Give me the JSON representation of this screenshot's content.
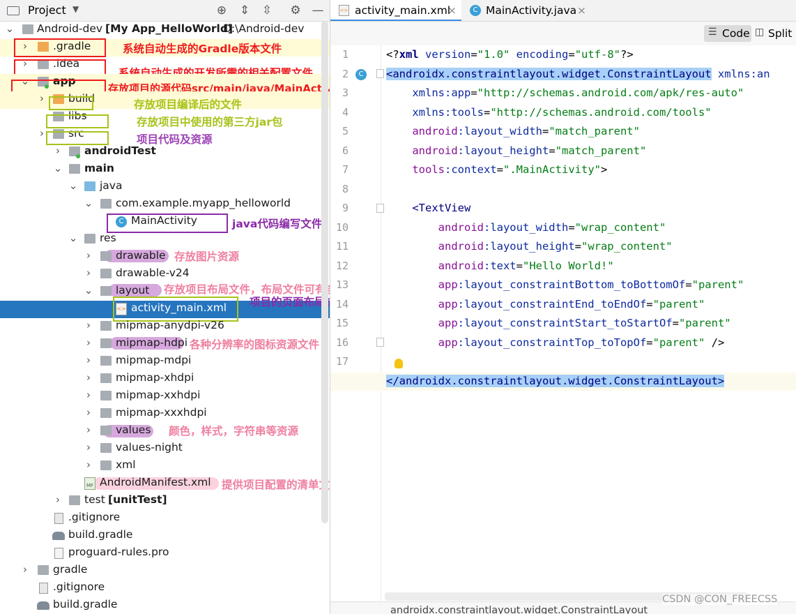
{
  "left_panel": {
    "header": {
      "title": "Project",
      "dropdown_glyph": "▼",
      "tools": [
        "locate-icon",
        "expand-icon",
        "collapse-icon",
        "gear-icon",
        "minimize-icon"
      ]
    },
    "tree": [
      {
        "arrow": "⌄",
        "label": "Android-dev",
        "bold_suffix": "[My App_HelloWorld]",
        "path": "D:\\Android-dev"
      },
      {
        "arrow": "›",
        "label": ".gradle"
      },
      {
        "arrow": "›",
        "label": ".idea"
      },
      {
        "arrow": "⌄",
        "label": "app"
      },
      {
        "arrow": "›",
        "label": "build"
      },
      {
        "arrow": "",
        "label": "libs"
      },
      {
        "arrow": "›",
        "label": "src"
      },
      {
        "arrow": "›",
        "label": "androidTest"
      },
      {
        "arrow": "⌄",
        "label": "main"
      },
      {
        "arrow": "⌄",
        "label": "java"
      },
      {
        "arrow": "⌄",
        "label": "com.example.myapp_helloworld"
      },
      {
        "arrow": "",
        "label": "MainActivity"
      },
      {
        "arrow": "⌄",
        "label": "res"
      },
      {
        "arrow": "›",
        "label": "drawable"
      },
      {
        "arrow": "›",
        "label": "drawable-v24"
      },
      {
        "arrow": "⌄",
        "label": "layout"
      },
      {
        "arrow": "",
        "label": "activity_main.xml"
      },
      {
        "arrow": "›",
        "label": "mipmap-anydpi-v26"
      },
      {
        "arrow": "›",
        "label": "mipmap-hdpi"
      },
      {
        "arrow": "›",
        "label": "mipmap-mdpi"
      },
      {
        "arrow": "›",
        "label": "mipmap-xhdpi"
      },
      {
        "arrow": "›",
        "label": "mipmap-xxhdpi"
      },
      {
        "arrow": "›",
        "label": "mipmap-xxxhdpi"
      },
      {
        "arrow": "›",
        "label": "values"
      },
      {
        "arrow": "›",
        "label": "values-night"
      },
      {
        "arrow": "›",
        "label": "xml"
      },
      {
        "arrow": "",
        "label": "AndroidManifest.xml",
        "icon_label": "MF"
      },
      {
        "arrow": "›",
        "label": "test",
        "bold_suffix": "[unitTest]"
      },
      {
        "arrow": "",
        "label": ".gitignore"
      },
      {
        "arrow": "",
        "label": "build.gradle"
      },
      {
        "arrow": "",
        "label": "proguard-rules.pro"
      },
      {
        "arrow": "›",
        "label": "gradle"
      },
      {
        "arrow": "",
        "label": ".gitignore"
      },
      {
        "arrow": "",
        "label": "build.gradle"
      }
    ],
    "annotations": {
      "gradle": "系统自动生成的Gradle版本文件",
      "idea": "系统自动生成的开发所需的相关配置文件",
      "app": "存放项目的源代码src/main/java/MainActivity、资源src/main/res",
      "build": "存放项目编译后的文件",
      "libs": "存放项目中使用的第三方jar包",
      "src": "项目代码及资源",
      "mainactivity": "java代码编写文件",
      "drawable": "存放图片资源",
      "layout": "存放项目布局文件，布局文件可有多个布局文件",
      "activity_main": "项目的页面布局文件",
      "mipmap": "各种分辨率的图标资源文件",
      "values": "颜色，样式，字符串等资源",
      "manifest": "提供项目配置的清单文件"
    }
  },
  "editor": {
    "tabs": [
      {
        "label": "activity_main.xml",
        "close": "×",
        "icon": "xml-file-icon"
      },
      {
        "label": "MainActivity.java",
        "close": "×",
        "icon": "class-c-icon"
      }
    ],
    "view_modes": {
      "code": "Code",
      "split": "Split"
    },
    "line_numbers": [
      "1",
      "2",
      "3",
      "4",
      "5",
      "6",
      "7",
      "8",
      "9",
      "10",
      "11",
      "12",
      "13",
      "14",
      "15",
      "16",
      "17",
      "18"
    ],
    "code": {
      "l1a": "<?",
      "l1b": "xml ",
      "l1c": "version",
      "l1d": "=",
      "l1e": "\"1.0\"",
      "l1f": " encoding",
      "l1g": "=",
      "l1h": "\"utf-8\"",
      "l1i": "?>",
      "l2a": "<androidx.constraintlayout.widget.ConstraintLayout",
      "l2b": " xmlns:an",
      "l3a": "    xmlns:app",
      "l3b": "=",
      "l3c": "\"http://schemas.android.com/apk/res-auto\"",
      "l4a": "    xmlns:tools",
      "l4b": "=",
      "l4c": "\"http://schemas.android.com/tools\"",
      "l5a": "    android",
      "l5b": ":layout_width",
      "l5c": "=",
      "l5d": "\"match_parent\"",
      "l6a": "    android",
      "l6b": ":layout_height",
      "l6c": "=",
      "l6d": "\"match_parent\"",
      "l7a": "    tools",
      "l7b": ":context",
      "l7c": "=",
      "l7d": "\".MainActivity\"",
      "l7e": ">",
      "l9a": "    <TextView",
      "l10a": "        android",
      "l10b": ":layout_width",
      "l10c": "=",
      "l10d": "\"wrap_content\"",
      "l11a": "        android",
      "l11b": ":layout_height",
      "l11c": "=",
      "l11d": "\"wrap_content\"",
      "l12a": "        android",
      "l12b": ":text",
      "l12c": "=",
      "l12d": "\"Hello World!\"",
      "l13a": "        app",
      "l13b": ":layout_constraintBottom_toBottomOf",
      "l13c": "=",
      "l13d": "\"parent\"",
      "l14a": "        app",
      "l14b": ":layout_constraintEnd_toEndOf",
      "l14c": "=",
      "l14d": "\"parent\"",
      "l15a": "        app",
      "l15b": ":layout_constraintStart_toStartOf",
      "l15c": "=",
      "l15d": "\"parent\"",
      "l16a": "        app",
      "l16b": ":layout_constraintTop_toTopOf",
      "l16c": "=",
      "l16d": "\"parent\"",
      "l16e": " />",
      "l18a": "</androidx.constraintlayout.widget.ConstraintLayout>"
    },
    "breadcrumb": "androidx.constraintlayout.widget.ConstraintLayout",
    "watermark": "CSDN @CON_FREECSS"
  },
  "colors": {
    "selection": "#2675bf",
    "red_annotation": "#ee1c1c",
    "green_annotation": "#a6c31b",
    "purple_annotation": "#8a2aa8",
    "pink_annotation": "#ef7fa0",
    "tag_highlight": "#a7d1f7"
  }
}
